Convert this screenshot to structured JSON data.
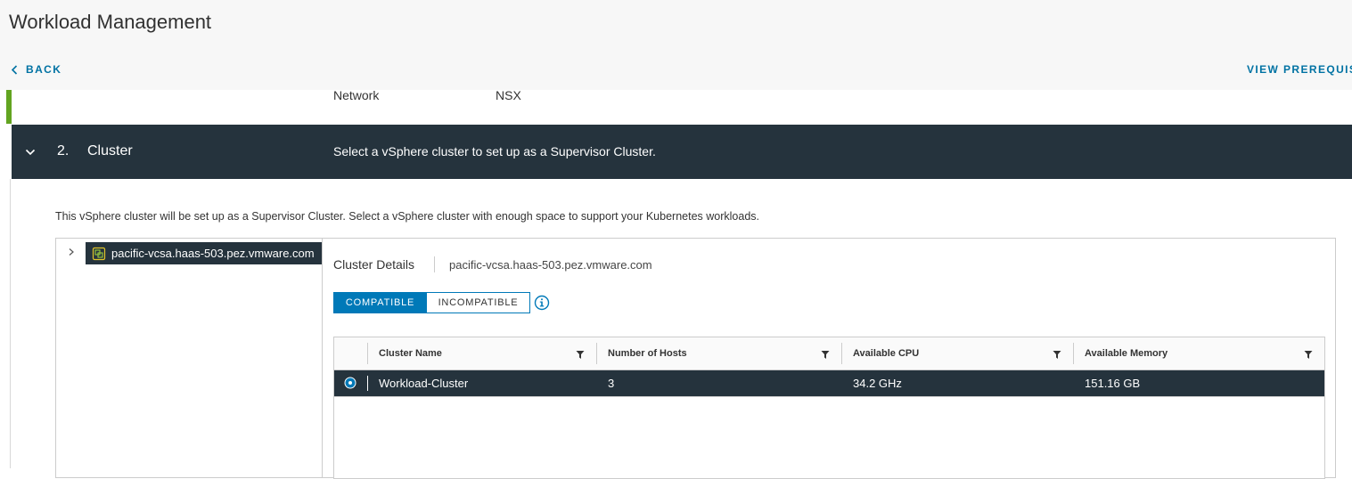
{
  "header": {
    "title": "Workload Management",
    "back_label": "BACK",
    "prereq_label": "VIEW PREREQUIS"
  },
  "network": {
    "label": "Network",
    "value": "NSX"
  },
  "step": {
    "number": "2.",
    "name": "Cluster",
    "description": "Select a vSphere cluster to set up as a Supervisor Cluster."
  },
  "intro": "This vSphere cluster will be set up as a Supervisor Cluster. Select a vSphere cluster with enough space to support your Kubernetes workloads.",
  "tree": {
    "node_label": "pacific-vcsa.haas-503.pez.vmware.com"
  },
  "details": {
    "title": "Cluster Details",
    "value": "pacific-vcsa.haas-503.pez.vmware.com"
  },
  "tabs": {
    "compatible": "COMPATIBLE",
    "incompatible": "INCOMPATIBLE",
    "selected": "COMPATIBLE"
  },
  "grid": {
    "columns": [
      "Cluster Name",
      "Number of Hosts",
      "Available CPU",
      "Available Memory"
    ],
    "rows": [
      {
        "name": "Workload-Cluster",
        "hosts": "3",
        "cpu": "34.2 GHz",
        "memory": "151.16 GB",
        "selected": true
      }
    ]
  },
  "colors": {
    "accent_blue": "#0079b8",
    "link_blue": "#0072a3",
    "dark_header": "#25333d",
    "step_done_green": "#62a420"
  },
  "icons": [
    "chevron-left-icon",
    "chevron-down-icon",
    "caret-right-icon",
    "cluster-icon",
    "info-icon",
    "filter-icon",
    "radio-selected-icon"
  ]
}
